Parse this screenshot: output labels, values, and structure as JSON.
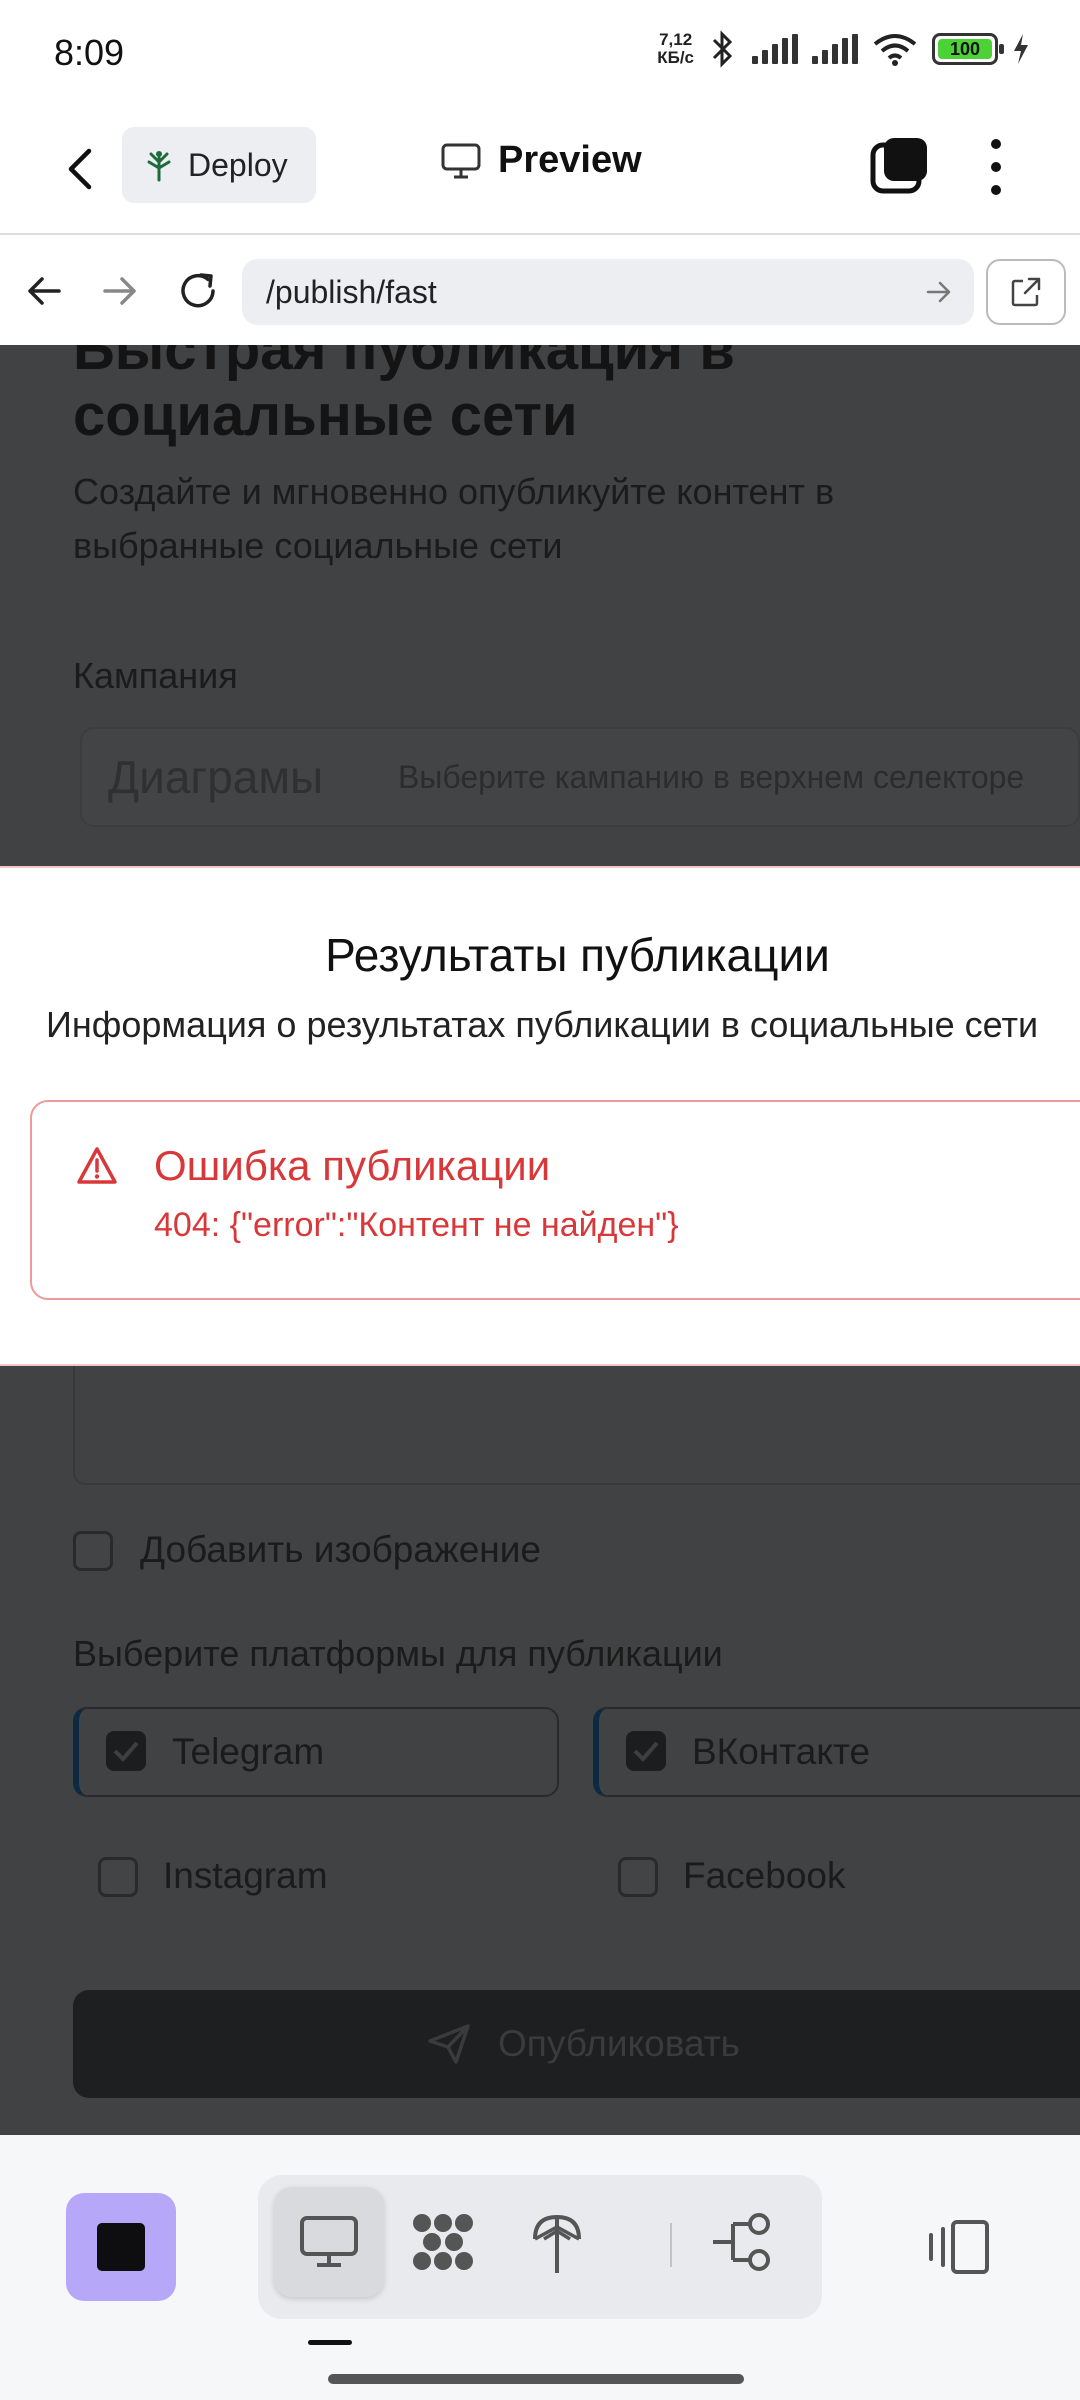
{
  "status_bar": {
    "time": "8:09",
    "net_speed_value": "7,12",
    "net_speed_unit": "КБ/с",
    "battery": "100"
  },
  "app_toolbar": {
    "deploy_label": "Deploy",
    "preview_label": "Preview"
  },
  "url_bar": {
    "url": "/publish/fast"
  },
  "page": {
    "title": "Быстрая публикация в социальные сети",
    "subtitle": "Создайте и мгновенно опубликуйте контент в выбранные социальные сети",
    "campaign_label": "Кампания",
    "campaign_value": "Диаграмы",
    "campaign_hint": "Выберите кампанию в верхнем селекторе",
    "add_image_label": "Добавить изображение",
    "add_image_checked": false,
    "platforms_label": "Выберите платформы для публикации",
    "platforms": [
      {
        "name": "Telegram",
        "checked": true
      },
      {
        "name": "ВКонтакте",
        "checked": true
      },
      {
        "name": "Instagram",
        "checked": false
      },
      {
        "name": "Facebook",
        "checked": false
      }
    ],
    "publish_label": "Опубликовать"
  },
  "dialog": {
    "title": "Результаты публикации",
    "description": "Информация о результатах публикации в социальные сети",
    "alert": {
      "title": "Ошибка публикации",
      "message": "404: {\"error\":\"Контент не найден\"}"
    }
  },
  "colors": {
    "overlay": "#414244",
    "error": "#d9383a",
    "error_border": "#ef9a9a",
    "stop_button": "#b7a7f9",
    "checkbox_accent": "#0d2a42"
  }
}
